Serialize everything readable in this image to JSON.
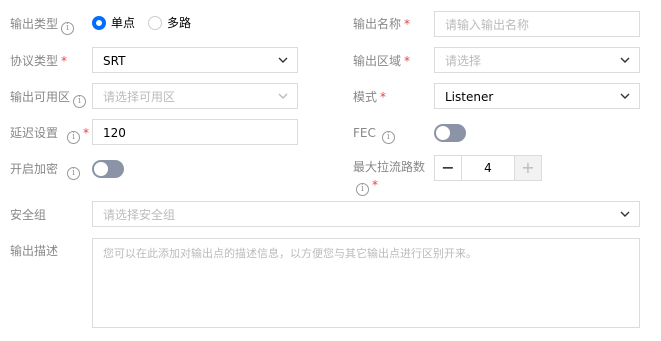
{
  "output_type": {
    "label": "输出类型",
    "options": [
      "单点",
      "多路"
    ],
    "selected": "单点"
  },
  "output_name": {
    "label": "输出名称",
    "placeholder": "请输入输出名称"
  },
  "protocol_type": {
    "label": "协议类型",
    "value": "SRT"
  },
  "output_region": {
    "label": "输出区域",
    "placeholder": "请选择"
  },
  "output_zone": {
    "label": "输出可用区",
    "placeholder": "请选择可用区"
  },
  "mode": {
    "label": "模式",
    "value": "Listener"
  },
  "latency": {
    "label": "延迟设置",
    "value": "120"
  },
  "fec": {
    "label": "FEC",
    "enabled": false
  },
  "encryption": {
    "label": "开启加密",
    "enabled": false
  },
  "max_pull_streams": {
    "label": "最大拉流路数",
    "value": "4",
    "decrement": "−",
    "increment": "+"
  },
  "security_group": {
    "label": "安全组",
    "placeholder": "请选择安全组"
  },
  "description": {
    "label": "输出描述",
    "placeholder": "您可以在此添加对输出点的描述信息，以方便您与其它输出点进行区别开来。"
  },
  "required_mark": "*",
  "info_glyph": "i",
  "icons": [
    "info-icon",
    "chevron-down-icon"
  ],
  "colors": {
    "accent": "#006eff",
    "required": "#e54545",
    "toggle_off": "#8a94a6",
    "border": "#dcdcdc"
  }
}
